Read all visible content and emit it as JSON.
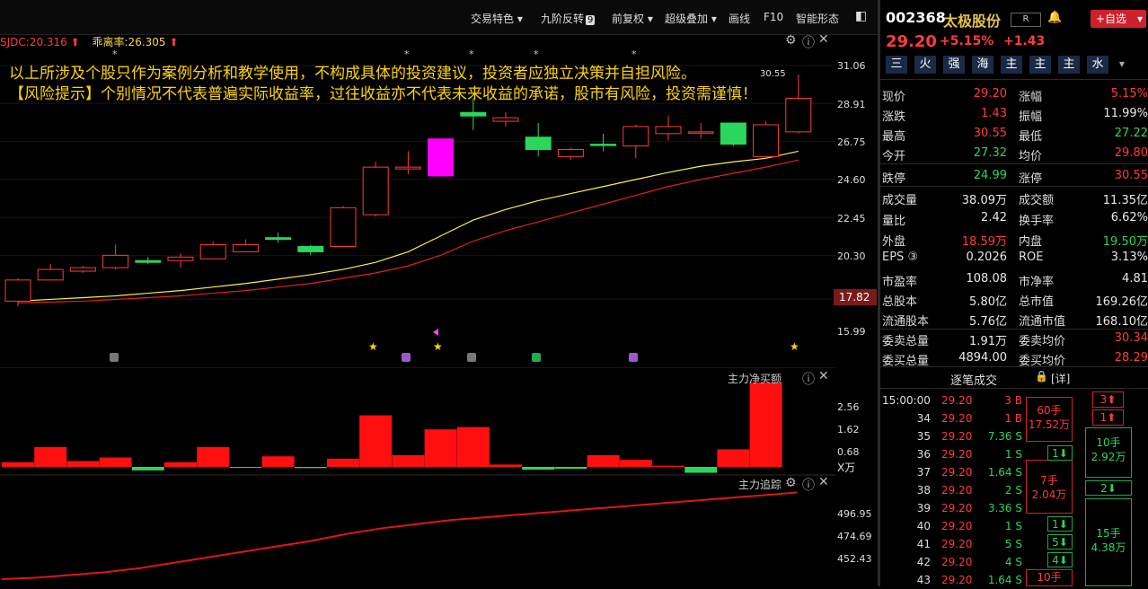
{
  "toolbar": {
    "items": [
      "交易特色",
      "九阶反转",
      "前复权",
      "超级叠加",
      "画线",
      "F10",
      "智能形态"
    ],
    "badge": "9"
  },
  "indicator": {
    "name1": "SJDC:20.316",
    "name2": "乖离率:26.305"
  },
  "warning": {
    "line1": "以上所涉及个股只作为案例分析和教学使用，不构成具体的投资建议，投资者应独立决策并自担风险。",
    "line2": "【风险提示】个别情况不代表普遍实际收益率，过往收益亦不代表未来收益的承诺，股市有风险，投资需谨慎！"
  },
  "main_axis": [
    "31.06",
    "28.91",
    "26.75",
    "24.60",
    "22.45",
    "20.30",
    "17.82",
    "15.99"
  ],
  "high_label": "30.55",
  "current_price_tag": "17.82",
  "sub1": {
    "title": "主力净买额",
    "axis": [
      "2.56",
      "1.62",
      "0.68"
    ],
    "unit": "X万"
  },
  "sub2": {
    "title": "主力追踪",
    "axis": [
      "496.95",
      "474.69",
      "452.43"
    ]
  },
  "chart_data": {
    "type": "candlestick",
    "candles": [
      {
        "o": 17.7,
        "c": 18.9,
        "h": 19.0,
        "l": 17.4,
        "color": "red"
      },
      {
        "o": 18.9,
        "c": 19.5,
        "h": 19.8,
        "l": 18.9,
        "color": "red"
      },
      {
        "o": 19.4,
        "c": 19.6,
        "h": 19.7,
        "l": 19.3,
        "color": "red"
      },
      {
        "o": 19.6,
        "c": 20.3,
        "h": 20.9,
        "l": 19.5,
        "color": "red"
      },
      {
        "o": 20.0,
        "c": 19.9,
        "h": 20.2,
        "l": 19.8,
        "color": "green"
      },
      {
        "o": 20.0,
        "c": 20.2,
        "h": 20.4,
        "l": 19.6,
        "color": "red"
      },
      {
        "o": 20.1,
        "c": 20.9,
        "h": 21.1,
        "l": 20.1,
        "color": "red"
      },
      {
        "o": 20.5,
        "c": 20.9,
        "h": 21.2,
        "l": 20.5,
        "color": "red"
      },
      {
        "o": 21.3,
        "c": 21.2,
        "h": 21.6,
        "l": 21.0,
        "color": "green"
      },
      {
        "o": 20.8,
        "c": 20.5,
        "h": 20.9,
        "l": 20.3,
        "color": "green"
      },
      {
        "o": 20.8,
        "c": 23.0,
        "h": 23.1,
        "l": 20.8,
        "color": "red"
      },
      {
        "o": 22.6,
        "c": 25.3,
        "h": 25.6,
        "l": 22.5,
        "color": "red"
      },
      {
        "o": 25.2,
        "c": 25.3,
        "h": 26.2,
        "l": 24.9,
        "color": "red"
      },
      {
        "o": 24.8,
        "c": 26.9,
        "h": 26.9,
        "l": 24.8,
        "color": "magenta"
      },
      {
        "o": 28.4,
        "c": 28.2,
        "h": 29.2,
        "l": 27.4,
        "color": "green"
      },
      {
        "o": 27.9,
        "c": 28.1,
        "h": 28.4,
        "l": 27.6,
        "color": "red"
      },
      {
        "o": 27.0,
        "c": 26.3,
        "h": 27.8,
        "l": 25.9,
        "color": "green"
      },
      {
        "o": 25.9,
        "c": 26.3,
        "h": 26.4,
        "l": 25.7,
        "color": "red"
      },
      {
        "o": 26.6,
        "c": 26.6,
        "h": 27.2,
        "l": 26.2,
        "color": "green"
      },
      {
        "o": 26.5,
        "c": 27.6,
        "h": 27.7,
        "l": 25.8,
        "color": "red"
      },
      {
        "o": 27.2,
        "c": 27.6,
        "h": 28.2,
        "l": 26.8,
        "color": "red"
      },
      {
        "o": 27.3,
        "c": 27.3,
        "h": 27.8,
        "l": 26.9,
        "color": "red"
      },
      {
        "o": 27.8,
        "c": 26.6,
        "h": 27.8,
        "l": 26.5,
        "color": "green"
      },
      {
        "o": 25.9,
        "c": 27.7,
        "h": 27.9,
        "l": 25.8,
        "color": "red"
      },
      {
        "o": 27.3,
        "c": 29.2,
        "h": 30.55,
        "l": 27.2,
        "color": "red"
      }
    ],
    "ma_yellow": [
      17.7,
      17.8,
      17.9,
      18.0,
      18.15,
      18.3,
      18.5,
      18.7,
      18.95,
      19.2,
      19.5,
      19.9,
      20.5,
      21.4,
      22.3,
      22.9,
      23.4,
      23.8,
      24.2,
      24.6,
      25.0,
      25.35,
      25.6,
      25.8,
      26.2
    ],
    "ma_red": [
      17.6,
      17.65,
      17.7,
      17.8,
      17.9,
      18.0,
      18.15,
      18.3,
      18.5,
      18.7,
      19.0,
      19.3,
      19.7,
      20.3,
      21.1,
      21.7,
      22.2,
      22.7,
      23.2,
      23.7,
      24.2,
      24.6,
      24.95,
      25.3,
      25.7
    ],
    "net_buy": [
      0.2,
      0.85,
      0.25,
      0.4,
      -0.15,
      0.2,
      0.85,
      -0.02,
      0.45,
      -0.05,
      0.35,
      2.2,
      0.5,
      1.6,
      1.7,
      0.1,
      -0.12,
      -0.08,
      0.5,
      0.3,
      0.05,
      -0.25,
      0.75,
      3.6
    ],
    "tracking": [
      452,
      453,
      455,
      457,
      460,
      464,
      468,
      472,
      476,
      480,
      485,
      489,
      492,
      495,
      497,
      499,
      501,
      503,
      505,
      507,
      509,
      511,
      513,
      515
    ]
  },
  "stock": {
    "code": "002368",
    "name": "太极股份",
    "badge": "R",
    "add": "+自选",
    "price": "29.20",
    "pct": "+5.15%",
    "diff": "+1.43"
  },
  "tags": [
    "三",
    "火",
    "强",
    "海",
    "主",
    "主",
    "主",
    "水"
  ],
  "quotes": [
    {
      "l1": "现价",
      "v1": "29.20",
      "c1": "red",
      "l2": "涨幅",
      "v2": "5.15%",
      "c2": "red"
    },
    {
      "l1": "涨跌",
      "v1": "1.43",
      "c1": "red",
      "l2": "振幅",
      "v2": "11.99%",
      "c2": "white"
    },
    {
      "l1": "最高",
      "v1": "30.55",
      "c1": "red",
      "l2": "最低",
      "v2": "27.22",
      "c2": "green"
    },
    {
      "l1": "今开",
      "v1": "27.32",
      "c1": "green",
      "l2": "均价",
      "v2": "29.80",
      "c2": "red"
    },
    {
      "l1": "跌停",
      "v1": "24.99",
      "c1": "green",
      "l2": "涨停",
      "v2": "30.55",
      "c2": "red"
    },
    {
      "l1": "成交量",
      "v1": "38.09万",
      "c1": "white",
      "l2": "成交额",
      "v2": "11.35亿",
      "c2": "white"
    },
    {
      "l1": "量比",
      "v1": "2.42",
      "c1": "white",
      "l2": "换手率",
      "v2": "6.62%",
      "c2": "white"
    },
    {
      "l1": "外盘",
      "v1": "18.59万",
      "c1": "red",
      "l2": "内盘",
      "v2": "19.50万",
      "c2": "green"
    },
    {
      "l1": "EPS ③",
      "v1": "0.2026",
      "c1": "white",
      "l2": "ROE",
      "v2": "3.13%",
      "c2": "white"
    },
    {
      "l1": "市盈率",
      "v1": "108.08",
      "c1": "white",
      "l2": "市净率",
      "v2": "4.81",
      "c2": "white"
    },
    {
      "l1": "总股本",
      "v1": "5.80亿",
      "c1": "white",
      "l2": "总市值",
      "v2": "169.26亿",
      "c2": "white"
    },
    {
      "l1": "流通股本",
      "v1": "5.76亿",
      "c1": "white",
      "l2": "流通市值",
      "v2": "168.10亿",
      "c2": "white"
    },
    {
      "l1": "委卖总量",
      "v1": "1.91万",
      "c1": "white",
      "l2": "委卖均价",
      "v2": "30.34",
      "c2": "red"
    },
    {
      "l1": "委买总量",
      "v1": "4894.00",
      "c1": "white",
      "l2": "委买均价",
      "v2": "28.29",
      "c2": "red"
    }
  ],
  "ticks_title": "逐笔成交",
  "ticks_detail": "[详]",
  "ticks": [
    {
      "t": "15:00:00",
      "p": "29.20",
      "v": "3 B",
      "c": "red"
    },
    {
      "t": "34",
      "p": "29.20",
      "v": "1 B",
      "c": "red"
    },
    {
      "t": "35",
      "p": "29.20",
      "v": "7.36 S",
      "c": "green"
    },
    {
      "t": "36",
      "p": "29.20",
      "v": "1 S",
      "c": "green"
    },
    {
      "t": "37",
      "p": "29.20",
      "v": "1.64 S",
      "c": "green"
    },
    {
      "t": "38",
      "p": "29.20",
      "v": "2 S",
      "c": "green"
    },
    {
      "t": "39",
      "p": "29.20",
      "v": "3.36 S",
      "c": "green"
    },
    {
      "t": "40",
      "p": "29.20",
      "v": "1 S",
      "c": "green"
    },
    {
      "t": "41",
      "p": "29.20",
      "v": "5 S",
      "c": "green"
    },
    {
      "t": "42",
      "p": "29.20",
      "v": "4 S",
      "c": "green"
    },
    {
      "t": "43",
      "p": "29.20",
      "v": "1.64 S",
      "c": "green"
    }
  ],
  "tick_boxes": {
    "b1a": "60手",
    "b1b": "17.52万",
    "b2a": "7手",
    "b2b": "2.04万",
    "b3": "10手",
    "g1a": "10手",
    "g1b": "2.92万",
    "g2a": "15手",
    "g2b": "4.38万",
    "m1": "3⬆",
    "m2": "1⬆",
    "m3": "1⬇",
    "m4": "2⬇",
    "m5": "1⬇",
    "m6": "5⬇",
    "m7": "4⬇"
  }
}
